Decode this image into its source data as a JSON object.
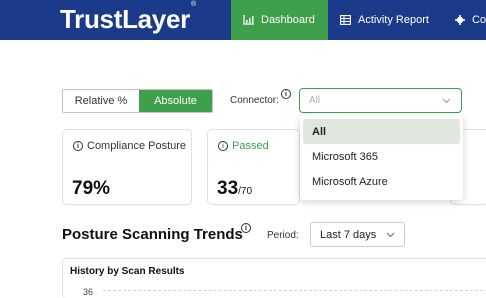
{
  "app": {
    "logo": "TrustLayer",
    "trademark": "®"
  },
  "nav": {
    "dashboard": "Dashboard",
    "activity_report": "Activity Report",
    "third": "Co"
  },
  "toggle": {
    "relative": "Relative %",
    "absolute": "Absolute",
    "selected": "Absolute"
  },
  "connector": {
    "label": "Connector:",
    "placeholder": "All",
    "options": [
      "All",
      "Microsoft 365",
      "Microsoft Azure"
    ],
    "highlighted": "All"
  },
  "cards": [
    {
      "title": "Compliance Posture",
      "value": "79%",
      "suffix": ""
    },
    {
      "title": "Passed",
      "value": "33",
      "suffix": "/70"
    }
  ],
  "trends": {
    "title": "Posture Scanning Trends",
    "period_label": "Period:",
    "period_value": "Last 7 days"
  },
  "chart": {
    "title": "History by Scan Results",
    "first_tick": "36"
  },
  "colors": {
    "brand": "#1b3b8a",
    "accent": "#3ea04a"
  },
  "icons": [
    "bar-chart-icon",
    "table-icon",
    "gear-icon",
    "info-icon",
    "chevron-down-icon"
  ]
}
